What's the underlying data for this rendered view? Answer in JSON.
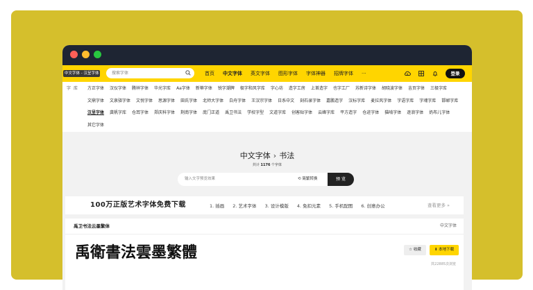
{
  "nav": {
    "logo": "中文字体 - 汉呈字体",
    "search_placeholder": "搜索字体",
    "items": [
      "首页",
      "中文字体",
      "英文字体",
      "图形字体",
      "字体神器",
      "招牌字体",
      "···"
    ],
    "active_index": 1,
    "login_label": "登录"
  },
  "categories": {
    "label": "字库",
    "items": [
      "方正字体",
      "汉仪字体",
      "腾祥字体",
      "华光字库",
      "Aa字体",
      "新蒂字体",
      "锐字潮牌",
      "极字和风字库",
      "字心坊",
      "造字工房",
      "上首造字",
      "也字工厂",
      "苏新诗字体",
      "胡晓波字体",
      "吉页字体",
      "三极字库",
      "文鼎字体",
      "文泉驿字体",
      "文悦字体",
      "思源字体",
      "田氏字体",
      "北师大字体",
      "白舟字体",
      "王汉宗字体",
      "日系中文",
      "刻石录字体",
      "嘉鹏造字",
      "汉标字库",
      "麦拉风字体",
      "字语字库",
      "字魂字库",
      "邯郸字库",
      "汉呈字体",
      "龚帆字库",
      "仓耳字体",
      "郑庆科字体",
      "荆南字体",
      "庞门正道",
      "禹卫书法",
      "学校字型",
      "文道字库",
      "创客贴字体",
      "云峰字库",
      "平方造字",
      "仓迹字体",
      "猫啃字体",
      "逐浪字体",
      "奶布儿字体",
      "其它字体"
    ],
    "highlight_index": 32
  },
  "hero": {
    "title_main": "中文字体",
    "title_sub": "书法",
    "count_prefix": "共计",
    "count_value": "1176",
    "count_suffix": "个字体",
    "preview_placeholder": "输入文字预览效果",
    "swap_label": "简繁转换",
    "preview_button": "预 览"
  },
  "banner": {
    "title": "100万正版艺术字体免费下载",
    "tabs": [
      "1. 插画",
      "2. 艺术字体",
      "3. 设计模版",
      "4. 免扣元素",
      "5. 手机配图",
      "6. 创意办公"
    ],
    "more": "查看更多 »"
  },
  "card": {
    "font_name": "禹卫书法云墨繁体",
    "category": "中文字体",
    "sample_text": "禹衛書法雲墨繁體",
    "favorite_label": "收藏",
    "download_label": "本地下载",
    "download_count": "共22885次浏览"
  },
  "colors": {
    "accent": "#ffd500",
    "frame": "#d5bf2c",
    "titlebar": "#1e2533"
  }
}
